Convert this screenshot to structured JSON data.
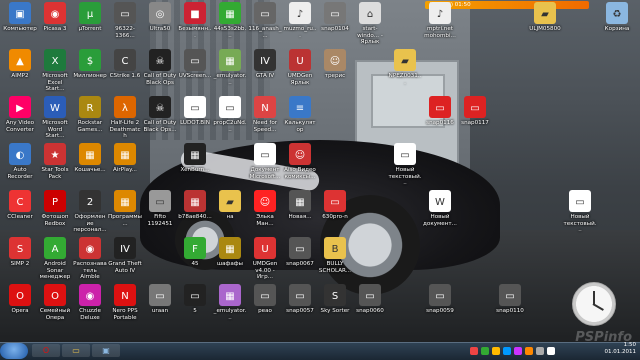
{
  "desktop": {
    "icons": [
      {
        "label": "Компьютер",
        "color": "#3a78c8",
        "glyph": "▣"
      },
      {
        "label": "Picasa 3",
        "color": "#d33",
        "glyph": "◉"
      },
      {
        "label": "µTorrent",
        "color": "#2a9d3a",
        "glyph": "µ"
      },
      {
        "label": "96322-1366...",
        "color": "#555",
        "glyph": "▭"
      },
      {
        "label": "Ultra50",
        "color": "#888",
        "glyph": "◎"
      },
      {
        "label": "Безымянн...",
        "color": "#c23",
        "glyph": "■"
      },
      {
        "label": "44s53s2bb...",
        "color": "#3a3",
        "glyph": "▦"
      },
      {
        "label": "116_anash_...",
        "color": "#666",
        "glyph": "▭"
      },
      {
        "label": "muzmo_ru...",
        "color": "#eee",
        "glyph": "♪"
      },
      {
        "label": "snap0104",
        "color": "#777",
        "glyph": "▭"
      },
      {
        "label": "start-windo... - Ярлык",
        "color": "#ddd",
        "glyph": "⌂"
      },
      {
        "label": "mptri.net mohombi...",
        "color": "#eee",
        "glyph": "♪"
      },
      {
        "label": "ULJM05800",
        "color": "#e9c24d",
        "glyph": "▰"
      },
      {
        "label": "Корзина",
        "color": "#8bb7e0",
        "glyph": "♻"
      },
      {
        "label": "AIMP2",
        "color": "#f08a00",
        "glyph": "▲"
      },
      {
        "label": "Microsoft Excel Start...",
        "color": "#1e7a3c",
        "glyph": "X"
      },
      {
        "label": "Миллионер",
        "color": "#2a9d3a",
        "glyph": "$"
      },
      {
        "label": "CStrike 1.6",
        "color": "#444",
        "glyph": "C"
      },
      {
        "label": "Call of Duty Black Ops",
        "color": "#222",
        "glyph": "☠"
      },
      {
        "label": "UVScreen...",
        "color": "#555",
        "glyph": "▭"
      },
      {
        "label": "_emulyator...",
        "color": "#7a5",
        "glyph": "▦"
      },
      {
        "label": "GTA IV",
        "color": "#333",
        "glyph": "IV"
      },
      {
        "label": "UMDGen Ярлык",
        "color": "#b33",
        "glyph": "U"
      },
      {
        "label": "трерис",
        "color": "#a86",
        "glyph": "☺"
      },
      {
        "label": "NPEZ0031...",
        "color": "#e9c24d",
        "glyph": "▰"
      },
      {
        "label": "Any Video Converter",
        "color": "#f06",
        "glyph": "▶"
      },
      {
        "label": "Microsoft Word Start...",
        "color": "#2b5db8",
        "glyph": "W"
      },
      {
        "label": "Rockstar Games...",
        "color": "#a81",
        "glyph": "R"
      },
      {
        "label": "Half-Life 2 Deathmatch",
        "color": "#d60",
        "glyph": "λ"
      },
      {
        "label": "Call of Duty Black Ops...",
        "color": "#222",
        "glyph": "☠"
      },
      {
        "label": "LUDOT.BIN",
        "color": "#fff",
        "glyph": "▭"
      },
      {
        "label": "propC2uNd...",
        "color": "#fff",
        "glyph": "▭"
      },
      {
        "label": "Need for Speed...",
        "color": "#d44",
        "glyph": "N"
      },
      {
        "label": "Калькулятор",
        "color": "#3a78c8",
        "glyph": "≡"
      },
      {
        "label": "snap0116",
        "color": "#d22",
        "glyph": "▭"
      },
      {
        "label": "snap0117",
        "color": "#d22",
        "glyph": "▭"
      },
      {
        "label": "Auto Recorder",
        "color": "#3a78c8",
        "glyph": "◐"
      },
      {
        "label": "Star Tools Pack",
        "color": "#c33",
        "glyph": "★"
      },
      {
        "label": "Кошачье...",
        "color": "#d80",
        "glyph": "▦"
      },
      {
        "label": "AirPlay...",
        "color": "#d80",
        "glyph": "▦"
      },
      {
        "label": "XenBurn...",
        "color": "#222",
        "glyph": "▦"
      },
      {
        "label": "Документ Microsoft...",
        "color": "#fff",
        "glyph": "▭"
      },
      {
        "label": "Aiso Видео комиксы...",
        "color": "#c33",
        "glyph": "☺"
      },
      {
        "label": "Новый текстовый...",
        "color": "#fff",
        "glyph": "▭"
      },
      {
        "label": "CCleaner",
        "color": "#e33",
        "glyph": "C"
      },
      {
        "label": "Фотошоп Redbox",
        "color": "#c00",
        "glyph": "P"
      },
      {
        "label": "Оформление персонал...",
        "color": "#333",
        "glyph": "2"
      },
      {
        "label": "Программы...",
        "color": "#d80",
        "glyph": "▦"
      },
      {
        "label": "Fifto 1192451",
        "color": "#999",
        "glyph": "▭"
      },
      {
        "label": "b78ae840...",
        "color": "#b33",
        "glyph": "▦"
      },
      {
        "label": "на",
        "color": "#e9c24d",
        "glyph": "▰"
      },
      {
        "label": "Элька Ман...",
        "color": "#f22",
        "glyph": "☺"
      },
      {
        "label": "Новая...",
        "color": "#555",
        "glyph": "▦"
      },
      {
        "label": "630pro-n",
        "color": "#d33",
        "glyph": "▭"
      },
      {
        "label": "Новый документ...",
        "color": "#fff",
        "glyph": "W"
      },
      {
        "label": "Новый текстовый...",
        "color": "#fff",
        "glyph": "▭"
      },
      {
        "label": "SIMP 2",
        "color": "#d33",
        "glyph": "S"
      },
      {
        "label": "Android Sonar менеджер",
        "color": "#3a3",
        "glyph": "A"
      },
      {
        "label": "Распознаватель Aimble",
        "color": "#c33",
        "glyph": "◉"
      },
      {
        "label": "Grand Theft Auto IV",
        "color": "#222",
        "glyph": "IV"
      },
      {
        "label": "45",
        "color": "#3a3",
        "glyph": "F"
      },
      {
        "label": "шафафы",
        "color": "#a81",
        "glyph": "▦"
      },
      {
        "label": "UMDGen v4.00 - Игр...",
        "color": "#d33",
        "glyph": "U"
      },
      {
        "label": "snap0067",
        "color": "#555",
        "glyph": "▭"
      },
      {
        "label": "BULLY SCHOLAR...",
        "color": "#e9c24d",
        "glyph": "B"
      },
      {
        "label": "Opera",
        "color": "#d11",
        "glyph": "O"
      },
      {
        "label": "Семейный Опера",
        "color": "#d11",
        "glyph": "O"
      },
      {
        "label": "Chuzzle Deluxe",
        "color": "#c2a",
        "glyph": "◉"
      },
      {
        "label": "Nero PPS Portable",
        "color": "#d11",
        "glyph": "N"
      },
      {
        "label": "uraan",
        "color": "#777",
        "glyph": "▭"
      },
      {
        "label": "5",
        "color": "#222",
        "glyph": "▭"
      },
      {
        "label": "_emulyator...",
        "color": "#a6c",
        "glyph": "▦"
      },
      {
        "label": "peao",
        "color": "#555",
        "glyph": "▭"
      },
      {
        "label": "snap0057",
        "color": "#555",
        "glyph": "▭"
      },
      {
        "label": "Sky Sorter",
        "color": "#333",
        "glyph": "S"
      },
      {
        "label": "snap0060",
        "color": "#555",
        "glyph": "▭"
      },
      {
        "label": "snap0059",
        "color": "#555",
        "glyph": "▭"
      },
      {
        "label": "snap0110",
        "color": "#555",
        "glyph": "▭"
      }
    ]
  },
  "gadget": {
    "title": "(\") (\") (\")",
    "time": "01:50"
  },
  "watermark": "PSPinfo",
  "taskbar": {
    "buttons": [
      {
        "name": "opera-taskbar-button",
        "glyph": "O",
        "color": "#d11"
      },
      {
        "name": "explorer-taskbar-button",
        "glyph": "▭",
        "color": "#e9c24d"
      },
      {
        "name": "computer-taskbar-button",
        "glyph": "▣",
        "color": "#8bb7e0"
      }
    ],
    "tray_colors": [
      "#e44",
      "#3a3",
      "#fb0",
      "#09f",
      "#c3f",
      "#f80",
      "#aaa",
      "#fff"
    ],
    "clock": {
      "time": "1:50",
      "date": "01.01.2011"
    }
  }
}
